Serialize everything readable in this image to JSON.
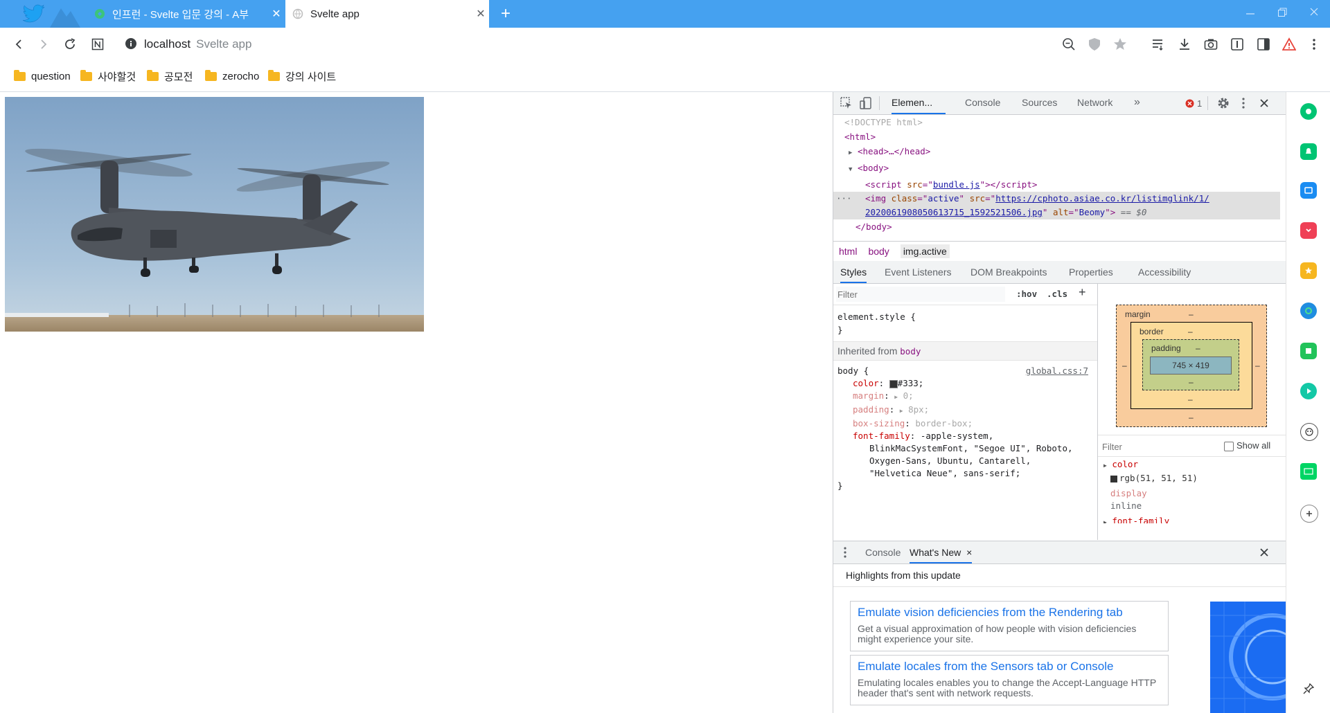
{
  "tabs": [
    {
      "title": "인프런 - Svelte 입문 강의 - A부",
      "close": "✕"
    },
    {
      "title": "Svelte app",
      "close": "✕"
    }
  ],
  "new_tab": "+",
  "address": {
    "host": "localhost",
    "title": "Svelte app"
  },
  "bookmarks": [
    "question",
    "사야할것",
    "공모전",
    "zerocho",
    "강의 사이트"
  ],
  "page": {
    "image_alt": "Beomy"
  },
  "devtools": {
    "tabs": [
      "Elemen...",
      "Console",
      "Sources",
      "Network",
      "»"
    ],
    "error_count": "1",
    "dom": {
      "doctype": "<!DOCTYPE html>",
      "html_open": "<html>",
      "head": "<head>…</head>",
      "body_open": "<body>",
      "script_src": "bundle.js",
      "img_class": "active",
      "img_src_line1": "https://cphoto.asiae.co.kr/listimglink/1/",
      "img_src_line2": "2020061908050613715_1592521506.jpg",
      "img_alt": "Beomy",
      "selected_marker": "== $0",
      "body_close": "</body>"
    },
    "breadcrumbs": [
      "html",
      "body",
      "img.active"
    ],
    "subtabs": [
      "Styles",
      "Event Listeners",
      "DOM Breakpoints",
      "Properties",
      "Accessibility"
    ],
    "styles": {
      "filter_placeholder": "Filter",
      "hov": ":hov",
      "cls": ".cls",
      "plus": "+",
      "element_style": "element.style {",
      "close_brace": "}",
      "inherited_label": "Inherited from",
      "inherited_tag": "body",
      "rule_selector": "body {",
      "rule_source": "global.css:7",
      "props": [
        {
          "name": "color",
          "value": "#333;"
        },
        {
          "name": "margin",
          "value": "0;"
        },
        {
          "name": "padding",
          "value": "8px;"
        },
        {
          "name": "box-sizing",
          "value": "border-box;"
        },
        {
          "name": "font-family",
          "value": "-apple-system,"
        }
      ],
      "font_lines": [
        "BlinkMacSystemFont, \"Segoe UI\", Roboto,",
        "Oxygen-Sans, Ubuntu, Cantarell,",
        "\"Helvetica Neue\", sans-serif;"
      ]
    },
    "box_model": {
      "margin": "margin",
      "border": "border",
      "padding": "padding",
      "content": "745 × 419",
      "dash": "–"
    },
    "computed": {
      "filter_placeholder": "Filter",
      "show_all": "Show all",
      "items": [
        {
          "name": "color",
          "value": "rgb(51, 51, 51)"
        },
        {
          "name": "display",
          "value": "inline"
        },
        {
          "name": "font-family",
          "value": ""
        }
      ]
    },
    "drawer": {
      "tabs": [
        "Console",
        "What's New"
      ],
      "close_x": "×",
      "header": "Highlights from this update",
      "cards": [
        {
          "title": "Emulate vision deficiencies from the Rendering tab",
          "body": "Get a visual approximation of how people with vision deficiencies might experience your site."
        },
        {
          "title": "Emulate locales from the Sensors tab or Console",
          "body": "Emulating locales enables you to change the Accept-Language HTTP header that's sent with network requests."
        }
      ]
    }
  },
  "colors": {
    "tabstrip": "#45a1f0",
    "accent": "#1a73e8"
  }
}
